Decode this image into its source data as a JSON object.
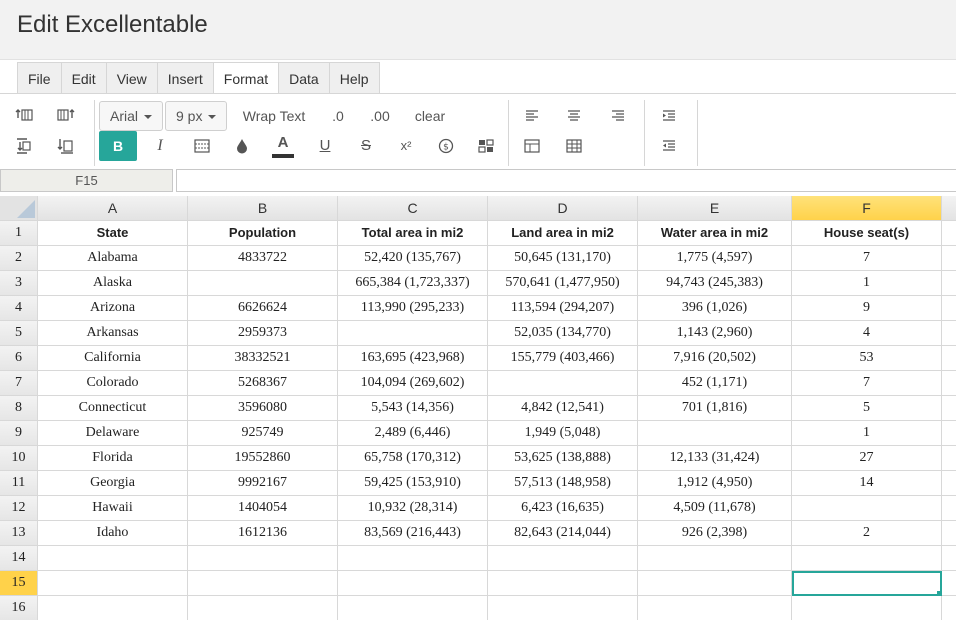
{
  "app": {
    "title": "Edit Excellentable"
  },
  "menu": [
    {
      "label": "File",
      "active": false
    },
    {
      "label": "Edit",
      "active": false
    },
    {
      "label": "View",
      "active": false
    },
    {
      "label": "Insert",
      "active": false
    },
    {
      "label": "Format",
      "active": true
    },
    {
      "label": "Data",
      "active": false
    },
    {
      "label": "Help",
      "active": false
    }
  ],
  "toolbar": {
    "font_family": "Arial",
    "font_size": "9 px",
    "wrap_text": "Wrap Text",
    "decrease_decimal": ".0",
    "increase_decimal": ".00",
    "clear": "clear",
    "bold": "B",
    "italic": "I",
    "text_color": "A",
    "underline": "U",
    "strikethrough": "S",
    "superscript": "x²",
    "accent_color": "#26a69a"
  },
  "formula_bar": {
    "cell_ref": "F15",
    "formula": ""
  },
  "sheet": {
    "selected_column": "F",
    "selected_row": "15",
    "columns": [
      "A",
      "B",
      "C",
      "D",
      "E",
      "F"
    ],
    "row_numbers": [
      "1",
      "2",
      "3",
      "4",
      "5",
      "6",
      "7",
      "8",
      "9",
      "10",
      "11",
      "12",
      "13",
      "14",
      "15",
      "16"
    ],
    "rows": [
      [
        "State",
        "Population",
        "Total area in mi2",
        "Land area in mi2",
        "Water area in mi2",
        "House seat(s)"
      ],
      [
        "Alabama",
        "4833722",
        "52,420 (135,767)",
        "50,645 (131,170)",
        "1,775 (4,597)",
        "7"
      ],
      [
        "Alaska",
        "",
        "665,384 (1,723,337)",
        "570,641 (1,477,950)",
        "94,743 (245,383)",
        "1"
      ],
      [
        "Arizona",
        "6626624",
        "113,990 (295,233)",
        "113,594 (294,207)",
        "396 (1,026)",
        "9"
      ],
      [
        "Arkansas",
        "2959373",
        "",
        "52,035 (134,770)",
        "1,143 (2,960)",
        "4"
      ],
      [
        "California",
        "38332521",
        "163,695 (423,968)",
        "155,779 (403,466)",
        "7,916 (20,502)",
        "53"
      ],
      [
        "Colorado",
        "5268367",
        "104,094 (269,602)",
        "",
        "452 (1,171)",
        "7"
      ],
      [
        "Connecticut",
        "3596080",
        "5,543 (14,356)",
        "4,842 (12,541)",
        "701 (1,816)",
        "5"
      ],
      [
        "Delaware",
        "925749",
        "2,489 (6,446)",
        "1,949 (5,048)",
        "",
        "1"
      ],
      [
        "Florida",
        "19552860",
        "65,758 (170,312)",
        "53,625 (138,888)",
        "12,133 (31,424)",
        "27"
      ],
      [
        "Georgia",
        "9992167",
        "59,425 (153,910)",
        "57,513 (148,958)",
        "1,912 (4,950)",
        "14"
      ],
      [
        "Hawaii",
        "1404054",
        "10,932 (28,314)",
        "6,423 (16,635)",
        "4,509 (11,678)",
        ""
      ],
      [
        "Idaho",
        "1612136",
        "83,569 (216,443)",
        "82,643 (214,044)",
        "926 (2,398)",
        "2"
      ],
      [
        "",
        "",
        "",
        "",
        "",
        ""
      ],
      [
        "",
        "",
        "",
        "",
        "",
        ""
      ],
      [
        "",
        "",
        "",
        "",
        "",
        ""
      ]
    ]
  }
}
